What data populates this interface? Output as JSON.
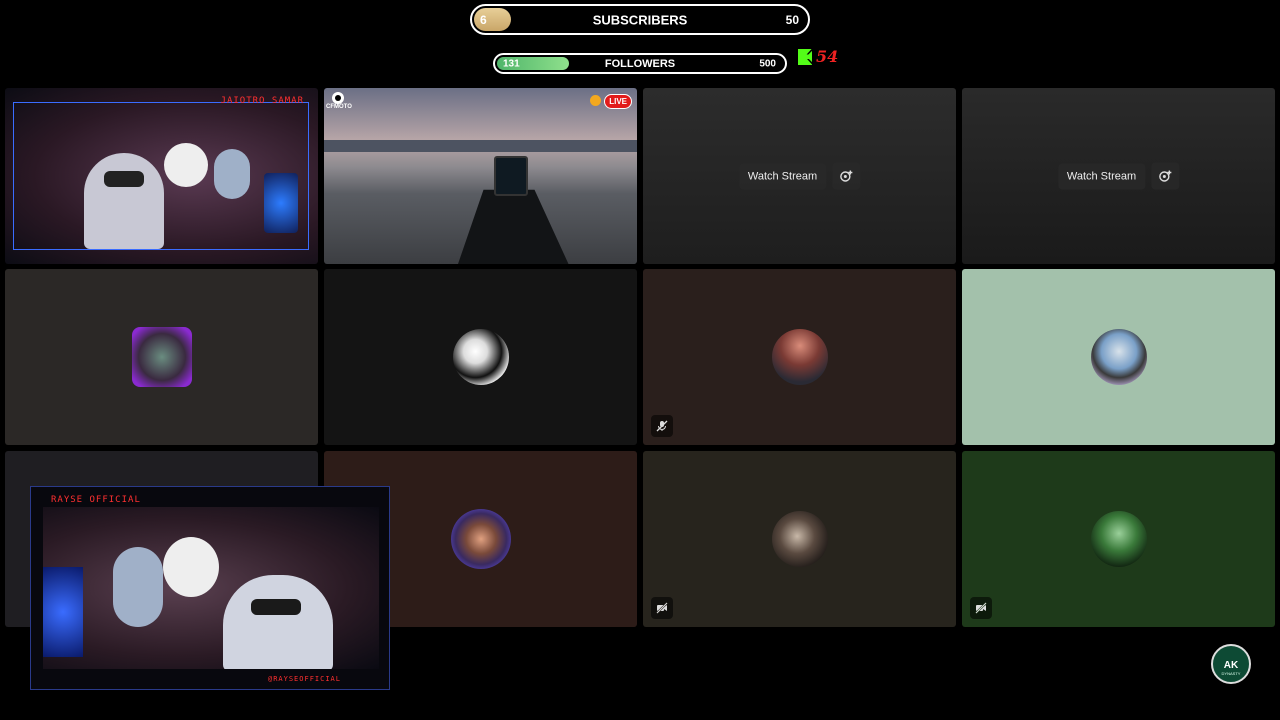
{
  "goals": {
    "subscribers": {
      "label": "SUBSCRIBERS",
      "current": "6",
      "target": "50",
      "progress": 0.12
    },
    "followers": {
      "label": "FOLLOWERS",
      "current": "131",
      "target": "500",
      "progress": 0.262
    }
  },
  "kick": {
    "count": "54"
  },
  "tiles": {
    "watch_label": "Watch Stream",
    "stream_cfmoto": {
      "brand": "CFMOTO",
      "live_badge": "LIVE"
    },
    "colors": {
      "gray_dark": "#2b2826",
      "black_tile": "#141414",
      "brown": "#2a1f1c",
      "mint": "#a3c1ab",
      "cocoa": "#2d1c18",
      "olive": "#27241d",
      "green": "#1e3a1a"
    }
  },
  "overlay": {
    "top_cam_title": "JAIOTRO SAMAR",
    "bottom_cam_title": "RAYSE OFFICIAL",
    "bottom_cam_handle": "@RAYSEOFFICIAL"
  },
  "logo": {
    "text": "AK",
    "sub": "DYNASTY"
  }
}
